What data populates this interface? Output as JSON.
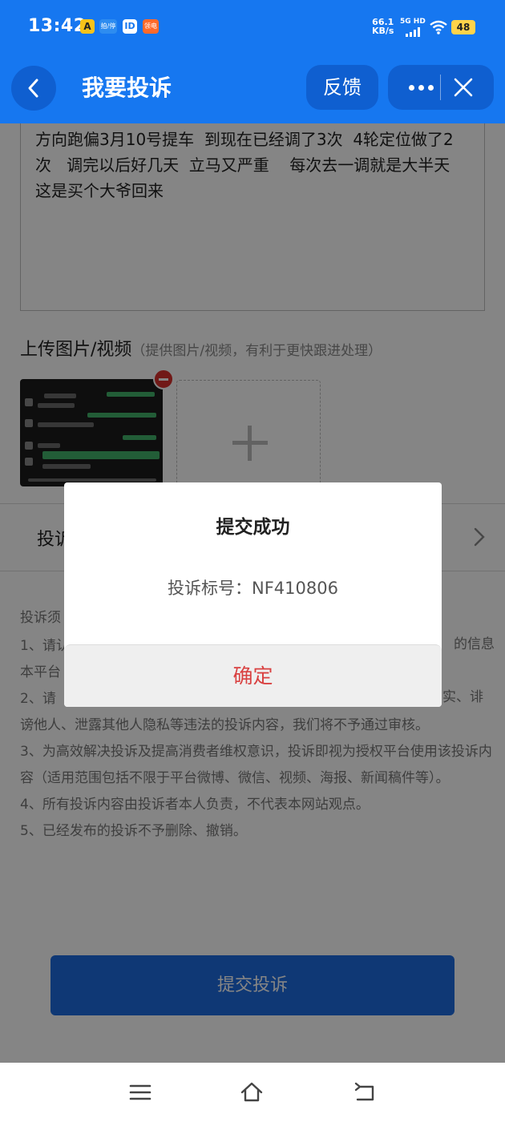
{
  "status_bar": {
    "time": "13:42",
    "apps": [
      "A",
      "拍/停",
      "ID",
      "领电"
    ],
    "speed_value": "66.1",
    "speed_unit": "KB/s",
    "network": "5G HD",
    "battery": "48"
  },
  "nav": {
    "title": "我要投诉",
    "feedback_label": "反馈",
    "back_icon": "chevron-left-icon",
    "more_icon": "more-dots-icon",
    "close_icon": "close-icon"
  },
  "complaint": {
    "text": "方向跑偏3月10号提车  到现在已经调了3次  4轮定位做了2次   调完以后好几天  立马又严重    每次去一调就是大半天   这是买个大爷回来"
  },
  "upload": {
    "title": "上传图片/视频",
    "hint": "（提供图片/视频，有利于更快跟进处理）"
  },
  "complaint_row_label": "投诉",
  "notice": {
    "title": "投诉须",
    "items": [
      "1、请认",
      "本平台",
      "2、请",
      "谤他人、泄露其他人隐私等违法的投诉内容，我们将不予通过审核。",
      "3、为高效解决投诉及提高消费者维权意识，投诉即视为授权平台使用该投诉内容（适用范围包括不限于平台微博、微信、视频、海报、新闻稿件等）。",
      "4、所有投诉内容由投诉者本人负责，不代表本网站观点。",
      "5、已经发布的投诉不予删除、撤销。"
    ],
    "right_fragment_1": "的信息",
    "right_fragment_2": "实、诽"
  },
  "submit_label": "提交投诉",
  "dialog": {
    "title": "提交成功",
    "message": "投诉标号：NF410806",
    "confirm_label": "确定"
  },
  "colors": {
    "brand_blue": "#1677f0",
    "confirm_red": "#d94141"
  }
}
